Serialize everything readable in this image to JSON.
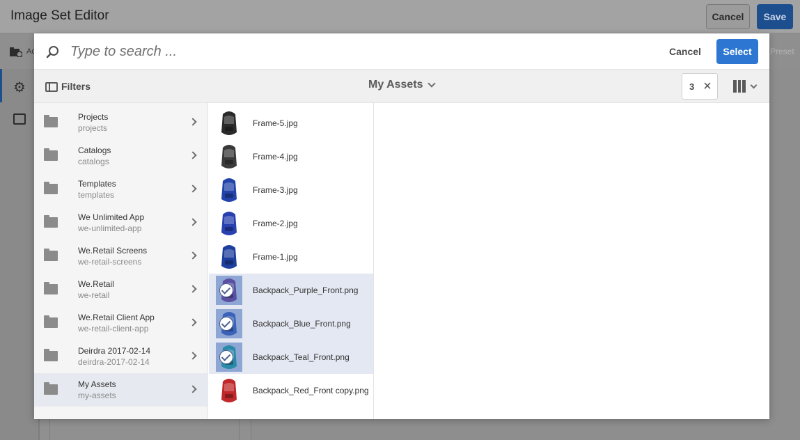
{
  "app": {
    "title": "Image Set Editor",
    "cancel_label": "Cancel",
    "save_label": "Save",
    "toolbar_label_fragment": "Ac",
    "preset_label_fragment": "Preset"
  },
  "modal": {
    "search": {
      "placeholder": "Type to search ..."
    },
    "cancel_label": "Cancel",
    "select_label": "Select",
    "filters_label": "Filters",
    "breadcrumb_title": "My Assets",
    "selection_count": "3",
    "clear_icon": "×",
    "view_icon": "column-view-icon"
  },
  "folders": [
    {
      "name": "Projects",
      "path": "projects"
    },
    {
      "name": "Catalogs",
      "path": "catalogs"
    },
    {
      "name": "Templates",
      "path": "templates"
    },
    {
      "name": "We Unlimited App",
      "path": "we-unlimited-app"
    },
    {
      "name": "We.Retail Screens",
      "path": "we-retail-screens"
    },
    {
      "name": "We.Retail",
      "path": "we-retail"
    },
    {
      "name": "We.Retail Client App",
      "path": "we-retail-client-app"
    },
    {
      "name": "Deirdra 2017-02-14",
      "path": "deirdra-2017-02-14"
    },
    {
      "name": "My Assets",
      "path": "my-assets",
      "selected": true
    }
  ],
  "assets": [
    {
      "name": "Frame-5.jpg",
      "color": "#2a2a2a",
      "selected": false
    },
    {
      "name": "Frame-4.jpg",
      "color": "#3a3a3a",
      "selected": false
    },
    {
      "name": "Frame-3.jpg",
      "color": "#2244aa",
      "selected": false
    },
    {
      "name": "Frame-2.jpg",
      "color": "#2840b0",
      "selected": false
    },
    {
      "name": "Frame-1.jpg",
      "color": "#1f3f9e",
      "selected": false
    },
    {
      "name": "Backpack_Purple_Front.png",
      "color": "#5a4fa0",
      "selected": true
    },
    {
      "name": "Backpack_Blue_Front.png",
      "color": "#3a62b8",
      "selected": true
    },
    {
      "name": "Backpack_Teal_Front.png",
      "color": "#2a8aa8",
      "selected": true
    },
    {
      "name": "Backpack_Red_Front copy.png",
      "color": "#c0282a",
      "selected": false
    }
  ],
  "colors": {
    "primary": "#2d77d2",
    "selection": "#e4e8f2"
  }
}
